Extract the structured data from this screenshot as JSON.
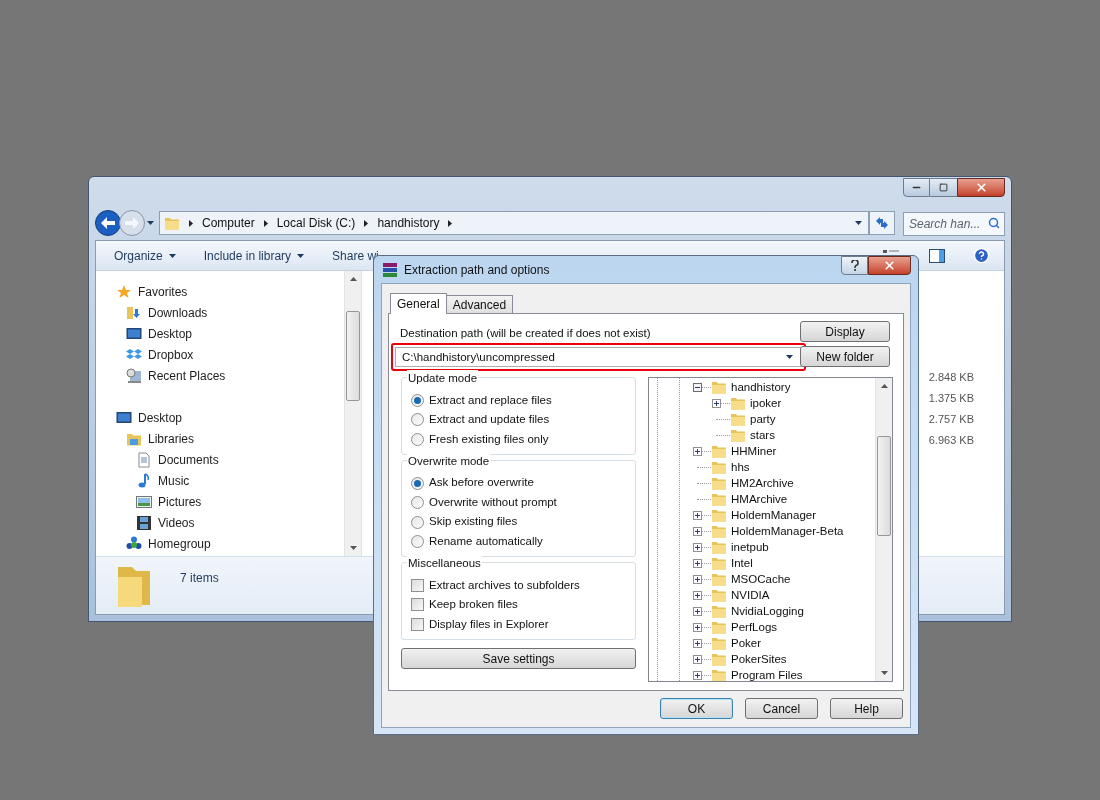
{
  "explorer": {
    "breadcrumb": [
      "Computer",
      "Local Disk (C:)",
      "handhistory"
    ],
    "search": {
      "placeholder": "Search han..."
    },
    "toolbar": [
      {
        "label": "Organize",
        "dropdown": true
      },
      {
        "label": "Include in library",
        "dropdown": true
      },
      {
        "label": "Share wi",
        "dropdown": false
      }
    ],
    "nav": [
      {
        "label": "Favorites",
        "kind": "star",
        "children": [
          {
            "label": "Downloads",
            "kind": "downloads"
          },
          {
            "label": "Desktop",
            "kind": "monitor"
          },
          {
            "label": "Dropbox",
            "kind": "dropbox"
          },
          {
            "label": "Recent Places",
            "kind": "recent"
          }
        ]
      },
      {
        "label": "Desktop",
        "kind": "monitor",
        "children": [
          {
            "label": "Libraries",
            "kind": "library",
            "children": [
              {
                "label": "Documents",
                "kind": "document"
              },
              {
                "label": "Music",
                "kind": "music"
              },
              {
                "label": "Pictures",
                "kind": "picture"
              },
              {
                "label": "Videos",
                "kind": "video"
              }
            ]
          },
          {
            "label": "Homegroup",
            "kind": "homegroup"
          }
        ]
      }
    ],
    "sizes": [
      "2.848 KB",
      "1.375 KB",
      "2.757 KB",
      "6.963 KB"
    ],
    "status": "7 items"
  },
  "dialog": {
    "title": "Extraction path and options",
    "tabs": [
      {
        "label": "General",
        "selected": true
      },
      {
        "label": "Advanced",
        "selected": false
      }
    ],
    "destination": {
      "label": "Destination path (will be created if does not exist)",
      "value": "C:\\handhistory\\uncompressed",
      "highlighted": true
    },
    "side_buttons": [
      "Display",
      "New folder"
    ],
    "groups": [
      {
        "title": "Update mode",
        "kind": "radio",
        "options": [
          {
            "label": "Extract and replace files",
            "selected": true
          },
          {
            "label": "Extract and update files",
            "selected": false
          },
          {
            "label": "Fresh existing files only",
            "selected": false
          }
        ]
      },
      {
        "title": "Overwrite mode",
        "kind": "radio",
        "options": [
          {
            "label": "Ask before overwrite",
            "selected": true
          },
          {
            "label": "Overwrite without prompt",
            "selected": false
          },
          {
            "label": "Skip existing files",
            "selected": false
          },
          {
            "label": "Rename automatically",
            "selected": false
          }
        ]
      },
      {
        "title": "Miscellaneous",
        "kind": "checkbox",
        "options": [
          {
            "label": "Extract archives to subfolders",
            "checked": false
          },
          {
            "label": "Keep broken files",
            "checked": false
          },
          {
            "label": "Display files in Explorer",
            "checked": false
          }
        ]
      }
    ],
    "save_button": "Save settings",
    "tree": [
      {
        "label": "handhistory",
        "expanded": true,
        "children": [
          {
            "label": "ipoker",
            "expanded": false
          },
          {
            "label": "party"
          },
          {
            "label": "stars"
          }
        ]
      },
      {
        "label": "HHMiner",
        "expanded": false
      },
      {
        "label": "hhs"
      },
      {
        "label": "HM2Archive"
      },
      {
        "label": "HMArchive"
      },
      {
        "label": "HoldemManager",
        "expanded": false
      },
      {
        "label": "HoldemManager-Beta",
        "expanded": false
      },
      {
        "label": "inetpub",
        "expanded": false
      },
      {
        "label": "Intel",
        "expanded": false
      },
      {
        "label": "MSOCache",
        "expanded": false
      },
      {
        "label": "NVIDIA",
        "expanded": false
      },
      {
        "label": "NvidiaLogging",
        "expanded": false
      },
      {
        "label": "PerfLogs",
        "expanded": false
      },
      {
        "label": "Poker",
        "expanded": false
      },
      {
        "label": "PokerSites",
        "expanded": false
      },
      {
        "label": "Program Files",
        "expanded": false
      }
    ],
    "buttons": [
      {
        "label": "OK",
        "default": true
      },
      {
        "label": "Cancel",
        "default": false
      },
      {
        "label": "Help",
        "default": false
      }
    ]
  }
}
